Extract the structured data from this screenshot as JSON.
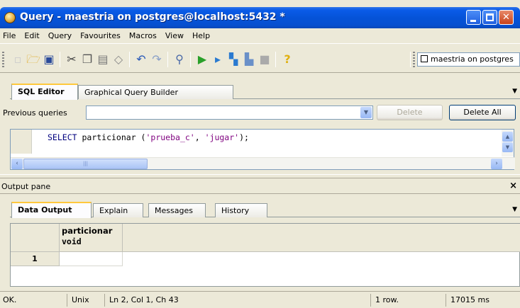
{
  "window": {
    "title": "Query - maestria on postgres@localhost:5432 *"
  },
  "menu": [
    "File",
    "Edit",
    "Query",
    "Favourites",
    "Macros",
    "View",
    "Help"
  ],
  "toolbar": {
    "connection_label": "maestria on postgres",
    "icons": [
      "new-icon",
      "open-folder-icon",
      "save-icon",
      "cut-icon",
      "copy-icon",
      "paste-icon",
      "clear-icon",
      "undo-icon",
      "redo-icon",
      "find-icon",
      "execute-icon",
      "execute-to-file-icon",
      "explain-icon",
      "explain-analyze-icon",
      "stop-icon",
      "help-icon"
    ]
  },
  "editor_tabs": [
    "SQL Editor",
    "Graphical Query Builder"
  ],
  "previous_queries": {
    "label": "Previous queries",
    "value": "",
    "delete_label": "Delete",
    "delete_all_label": "Delete All"
  },
  "editor": {
    "kw": "SELECT",
    "fn": " particionar (",
    "arg1": "'prueba_c'",
    "sep": ", ",
    "arg2": "'jugar'",
    "end": ");"
  },
  "output_pane": {
    "title": "Output pane",
    "close_glyph": "×",
    "tabs": [
      "Data Output",
      "Explain",
      "Messages",
      "History"
    ],
    "columns": [
      {
        "name": "particionar",
        "type": "void"
      }
    ],
    "rows": [
      {
        "num": "1",
        "values": [
          ""
        ]
      }
    ]
  },
  "status": {
    "state": "OK.",
    "eol": "Unix",
    "position": "Ln 2, Col 1, Ch 43",
    "rows": "1 row.",
    "time": "17015 ms"
  }
}
